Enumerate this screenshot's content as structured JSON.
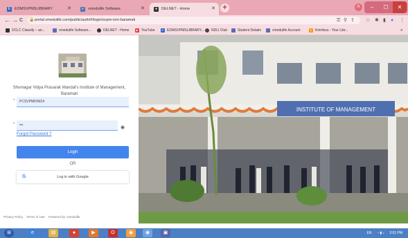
{
  "browser": {
    "tabs": [
      {
        "label": "EDMSVPMSLIBRARY",
        "color": "#2f66c7",
        "glyph": "E"
      },
      {
        "label": "vmedulife Software",
        "color": "#5a6fb0",
        "glyph": "v"
      },
      {
        "label": "DELNET - Home",
        "color": "#333333",
        "glyph": "●"
      }
    ],
    "new_tab": "+",
    "profile": "A",
    "window_controls": [
      "–",
      "☐",
      "✕"
    ],
    "back": "←",
    "forward": "→",
    "reload": "C",
    "url": "portal.vmedulife.com/public/auth/#/login/svpm-iom-baramati",
    "address_icons": [
      "key-icon",
      "search-icon",
      "share-icon",
      "star-icon",
      "extension-icon",
      "sidebar-icon",
      "profile-icon",
      "menu-icon"
    ],
    "bookmarks": [
      {
        "label": "DCLC Classify – an...",
        "color": "#333333"
      },
      {
        "label": "vmedulife Software...",
        "color": "#5a6fb0"
      },
      {
        "label": "DELNET - Home",
        "color": "#333333"
      },
      {
        "label": "YouTube",
        "color": "#e53935"
      },
      {
        "label": "EDMSVPMSLIBRARY...",
        "color": "#2f66c7"
      },
      {
        "label": "NDLI Club",
        "color": "#444444"
      },
      {
        "label": "Student Details",
        "color": "#5a6fb0"
      },
      {
        "label": "vmedulife Account",
        "color": "#5a6fb0"
      },
      {
        "label": "Knimbus - Your Libr...",
        "color": "#f39c12"
      }
    ]
  },
  "login": {
    "institute_name": "Shivnagar Vidya Prasarak Mandal's Institute of Management, Baramati",
    "username_value": "PCSVPMIOM24",
    "password_value": "•••",
    "required_mark": "*",
    "forgot_password": "Forgot Password ?",
    "login_button": "Login",
    "or_text": "OR",
    "google_button": "Log in with Google",
    "google_glyph": "G",
    "footer_links": [
      "Privacy Policy",
      "Terms of Use",
      "Powered by: vmedulife"
    ]
  },
  "photo": {
    "banner_text": "INSTITUTE OF MANAGEMENT"
  },
  "taskbar": {
    "tray_text": "EN",
    "time": "2:01 PM"
  }
}
